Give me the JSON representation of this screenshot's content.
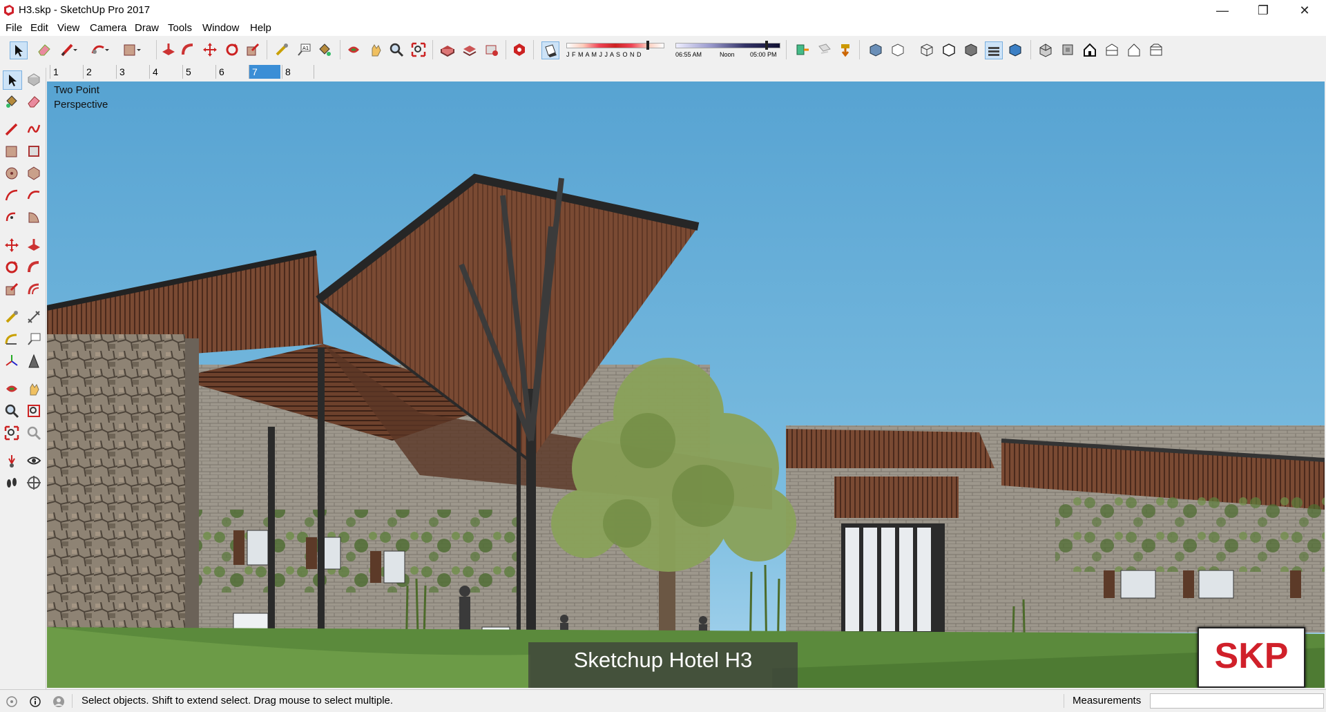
{
  "window": {
    "title": "H3.skp - SketchUp Pro 2017"
  },
  "menu": [
    "File",
    "Edit",
    "View",
    "Camera",
    "Draw",
    "Tools",
    "Window",
    "Help"
  ],
  "shadow": {
    "months": "J F M A M J J A S O N D",
    "time_start": "06:55 AM",
    "time_noon": "Noon",
    "time_end": "05:00 PM"
  },
  "scenes": {
    "tabs": [
      "1",
      "2",
      "3",
      "4",
      "5",
      "6",
      "7",
      "8"
    ],
    "active": "7"
  },
  "viewport": {
    "camera_label": "Two Point Perspective",
    "caption": "Sketchup Hotel H3",
    "logo_text": "SKP"
  },
  "status": {
    "message": "Select objects. Shift to extend select. Drag mouse to select multiple.",
    "measurements_label": "Measurements",
    "measurements_value": ""
  },
  "colors": {
    "sky": "#5ba6d0",
    "roof_wood": "#7a4a33",
    "grass": "#5b8a3c",
    "logo_red": "#d0202a",
    "active_scene": "#3b8ed6"
  }
}
